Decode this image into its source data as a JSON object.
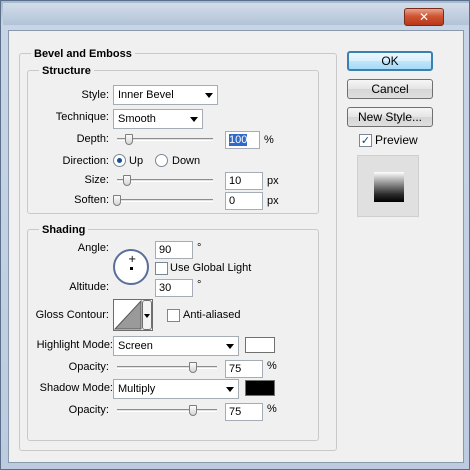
{
  "window": {
    "close_glyph": "✕"
  },
  "bevel_emboss": {
    "title": "Bevel and Emboss",
    "structure": {
      "title": "Structure",
      "style_label": "Style:",
      "style_value": "Inner Bevel",
      "technique_label": "Technique:",
      "technique_value": "Smooth",
      "depth_label": "Depth:",
      "depth_value": "100",
      "depth_unit": "%",
      "depth_slider_fraction": 0.1,
      "direction_label": "Direction:",
      "direction_up": "Up",
      "direction_down": "Down",
      "direction_selected": "Up",
      "size_label": "Size:",
      "size_value": "10",
      "size_unit": "px",
      "soften_label": "Soften:",
      "soften_value": "0",
      "soften_unit": "px"
    },
    "shading": {
      "title": "Shading",
      "angle_label": "Angle:",
      "angle_value": "90",
      "angle_unit": "°",
      "use_global_light_label": "Use Global Light",
      "use_global_light_checked": false,
      "altitude_label": "Altitude:",
      "altitude_value": "30",
      "altitude_unit": "°",
      "gloss_contour_label": "Gloss Contour:",
      "anti_aliased_label": "Anti-aliased",
      "anti_aliased_checked": false,
      "highlight_mode_label": "Highlight Mode:",
      "highlight_mode_value": "Screen",
      "highlight_color": "#ffffff",
      "highlight_opacity_label": "Opacity:",
      "highlight_opacity_value": "75",
      "highlight_opacity_unit": "%",
      "shadow_mode_label": "Shadow Mode:",
      "shadow_mode_value": "Multiply",
      "shadow_color": "#000000",
      "shadow_opacity_label": "Opacity:",
      "shadow_opacity_value": "75",
      "shadow_opacity_unit": "%"
    }
  },
  "buttons": {
    "ok": "OK",
    "cancel": "Cancel",
    "new_style": "New Style...",
    "preview_label": "Preview",
    "preview_checked": true
  },
  "icons": {
    "check_glyph": "✓",
    "crosshair_glyph": "+"
  }
}
